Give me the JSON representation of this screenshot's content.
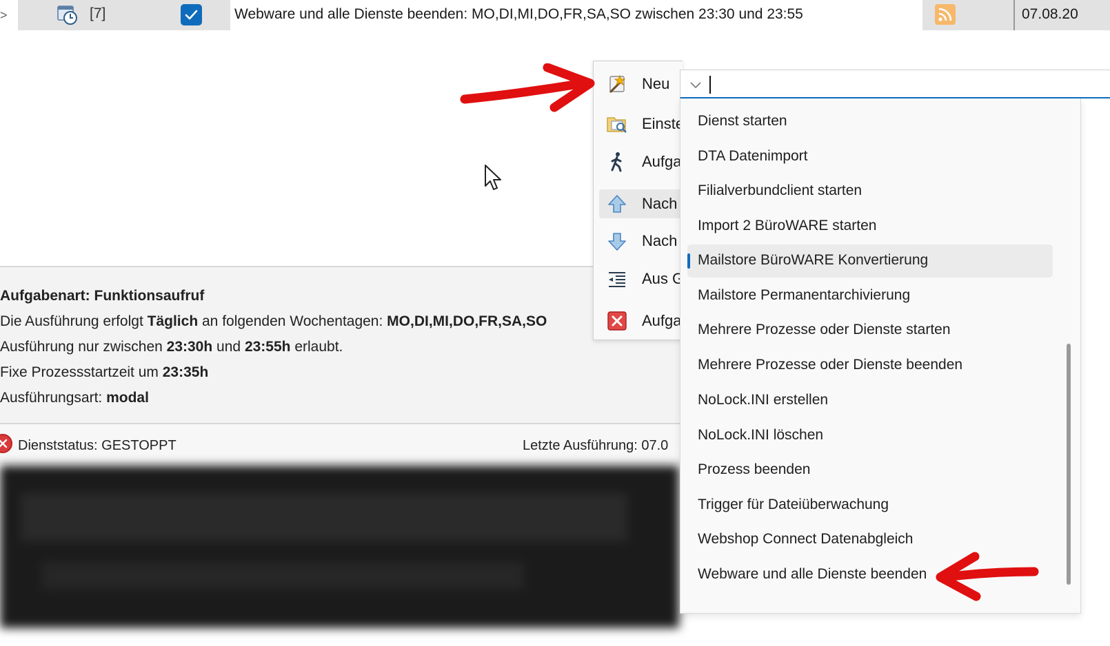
{
  "task_row": {
    "expander": ">",
    "id": "[7]",
    "description": "Webware und alle Dienste beenden: MO,DI,MI,DO,FR,SA,SO zwischen 23:30 und 23:55",
    "date": "07.08.20"
  },
  "info": {
    "task_type_label": "Aufgabenart:",
    "task_type_value": "Funktionsaufruf",
    "schedule_prefix": "Die Ausführung erfolgt",
    "schedule_freq": "Täglich",
    "schedule_mid": "an folgenden Wochentagen:",
    "schedule_days": "MO,DI,MI,DO,FR,SA,SO",
    "window_prefix": "Ausführung nur zwischen",
    "window_start": "23:30h",
    "window_and": "und",
    "window_end": "23:55h",
    "window_suffix": "erlaubt.",
    "fixed_prefix": "Fixe Prozessstartzeit um",
    "fixed_time": "23:35h",
    "mode_label": "Ausführungsart:",
    "mode_value": "modal"
  },
  "status": {
    "service_status": "Dienststatus: GESTOPPT",
    "last_run": "Letzte Ausführung:  07.0"
  },
  "context_menu": {
    "items": [
      {
        "label": "Neu",
        "icon": "magic-wand-icon"
      },
      {
        "label": "Einste",
        "icon": "settings-folder-icon"
      },
      {
        "label": "Aufga",
        "icon": "runner-icon"
      },
      {
        "label": "Nach",
        "icon": "arrow-up-icon"
      },
      {
        "label": "Nach",
        "icon": "arrow-down-icon"
      },
      {
        "label": "Aus G",
        "icon": "outdent-icon"
      },
      {
        "label": "Aufga",
        "icon": "delete-icon"
      }
    ]
  },
  "combo": {
    "value": ""
  },
  "dropdown": {
    "selected_index": 4,
    "items": [
      "Dienst starten",
      "DTA Datenimport",
      "Filialverbundclient starten",
      "Import 2 BüroWARE starten",
      "Mailstore BüroWARE Konvertierung",
      "Mailstore Permanentarchivierung",
      "Mehrere Prozesse oder Dienste starten",
      "Mehrere Prozesse oder Dienste beenden",
      "NoLock.INI erstellen",
      "NoLock.INI löschen",
      "Prozess beenden",
      "Trigger für Dateiüberwachung",
      "Webshop Connect Datenabgleich",
      "Webware und alle Dienste beenden"
    ]
  },
  "colors": {
    "accent": "#0f6cbd",
    "annotation_arrow": "#e01010",
    "error": "#d93a3a"
  }
}
